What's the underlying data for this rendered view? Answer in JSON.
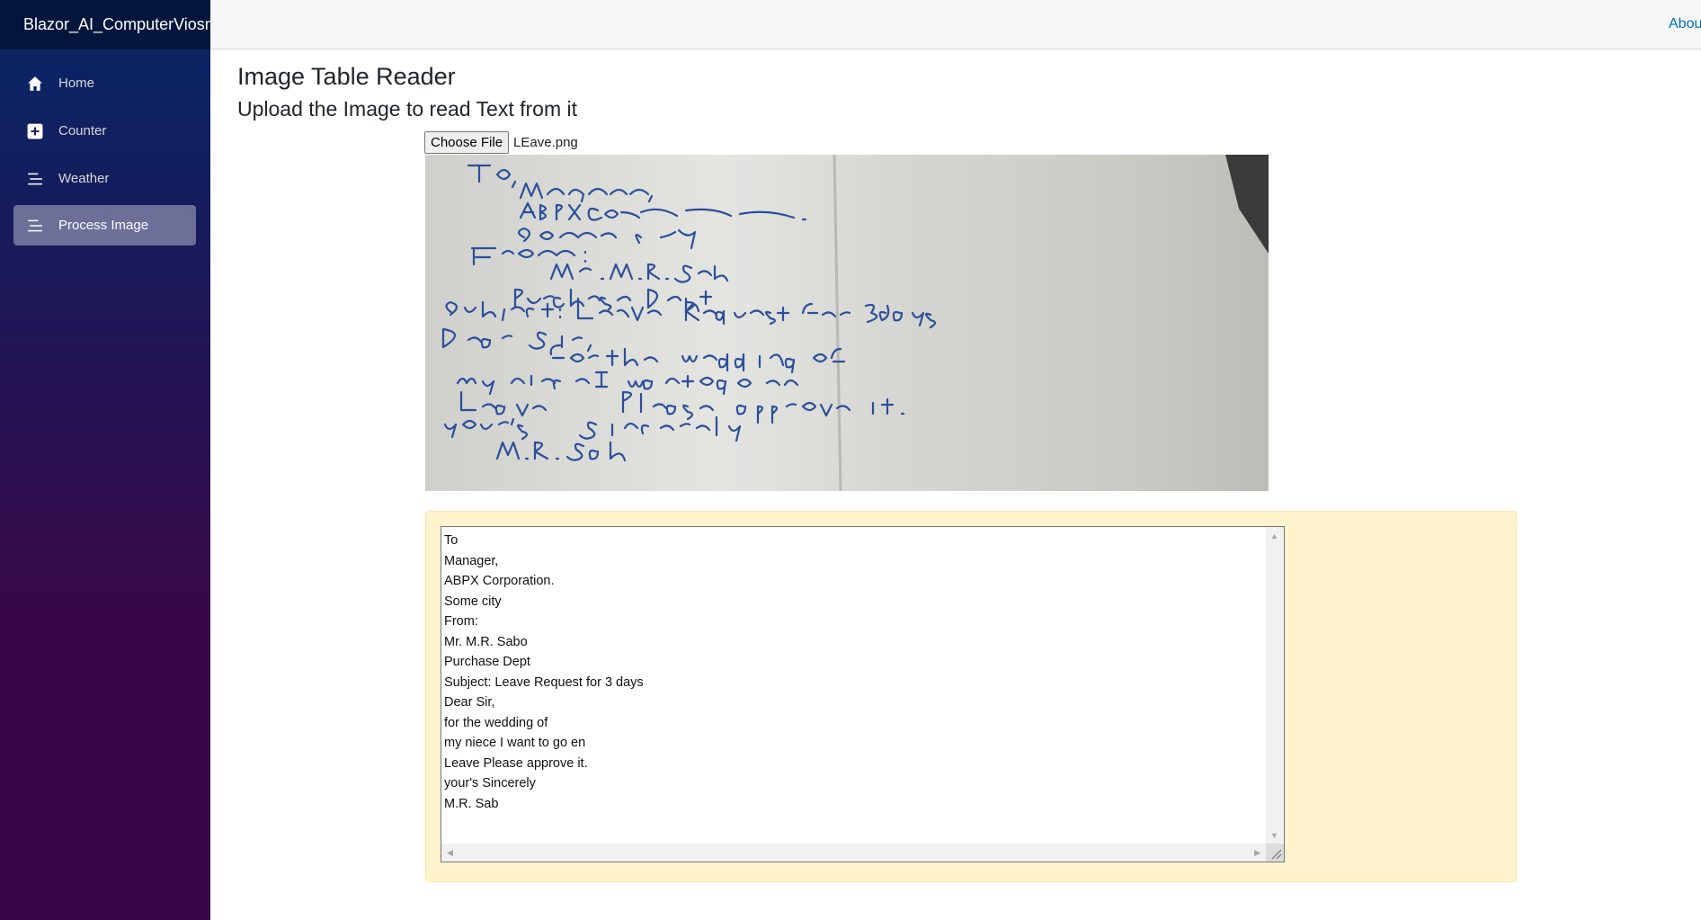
{
  "app": {
    "brand": "Blazor_AI_ComputerViosn_I"
  },
  "top_row": {
    "about_link": "About"
  },
  "sidebar": {
    "items": [
      {
        "label": "Home",
        "icon": "home-icon",
        "active": false
      },
      {
        "label": "Counter",
        "icon": "plus-square-icon",
        "active": false
      },
      {
        "label": "Weather",
        "icon": "list-icon",
        "active": false
      },
      {
        "label": "Process Image",
        "icon": "list-icon",
        "active": true
      }
    ]
  },
  "main": {
    "title": "Image Table Reader",
    "subtitle": "Upload the Image to read Text from it",
    "file_input": {
      "button_label": "Choose File",
      "file_name": "LEave.png"
    },
    "result_lines": [
      "To",
      "Manager,",
      "ABPX Corporation.",
      "Some city",
      "From:",
      "Mr. M.R. Sabo",
      "Purchase Dept",
      "Subject: Leave Request for 3 days",
      "Dear Sir,",
      "for the wedding of",
      "my niece I want to go en",
      "Leave Please approve it.",
      "your's Sincerely",
      "M.R. Sab"
    ]
  },
  "colors": {
    "sidebar_top": "#052767",
    "sidebar_bottom": "#3a0647",
    "link": "#0071c1",
    "result_panel_bg": "#fff3cd",
    "ink": "#2a4e9a"
  }
}
